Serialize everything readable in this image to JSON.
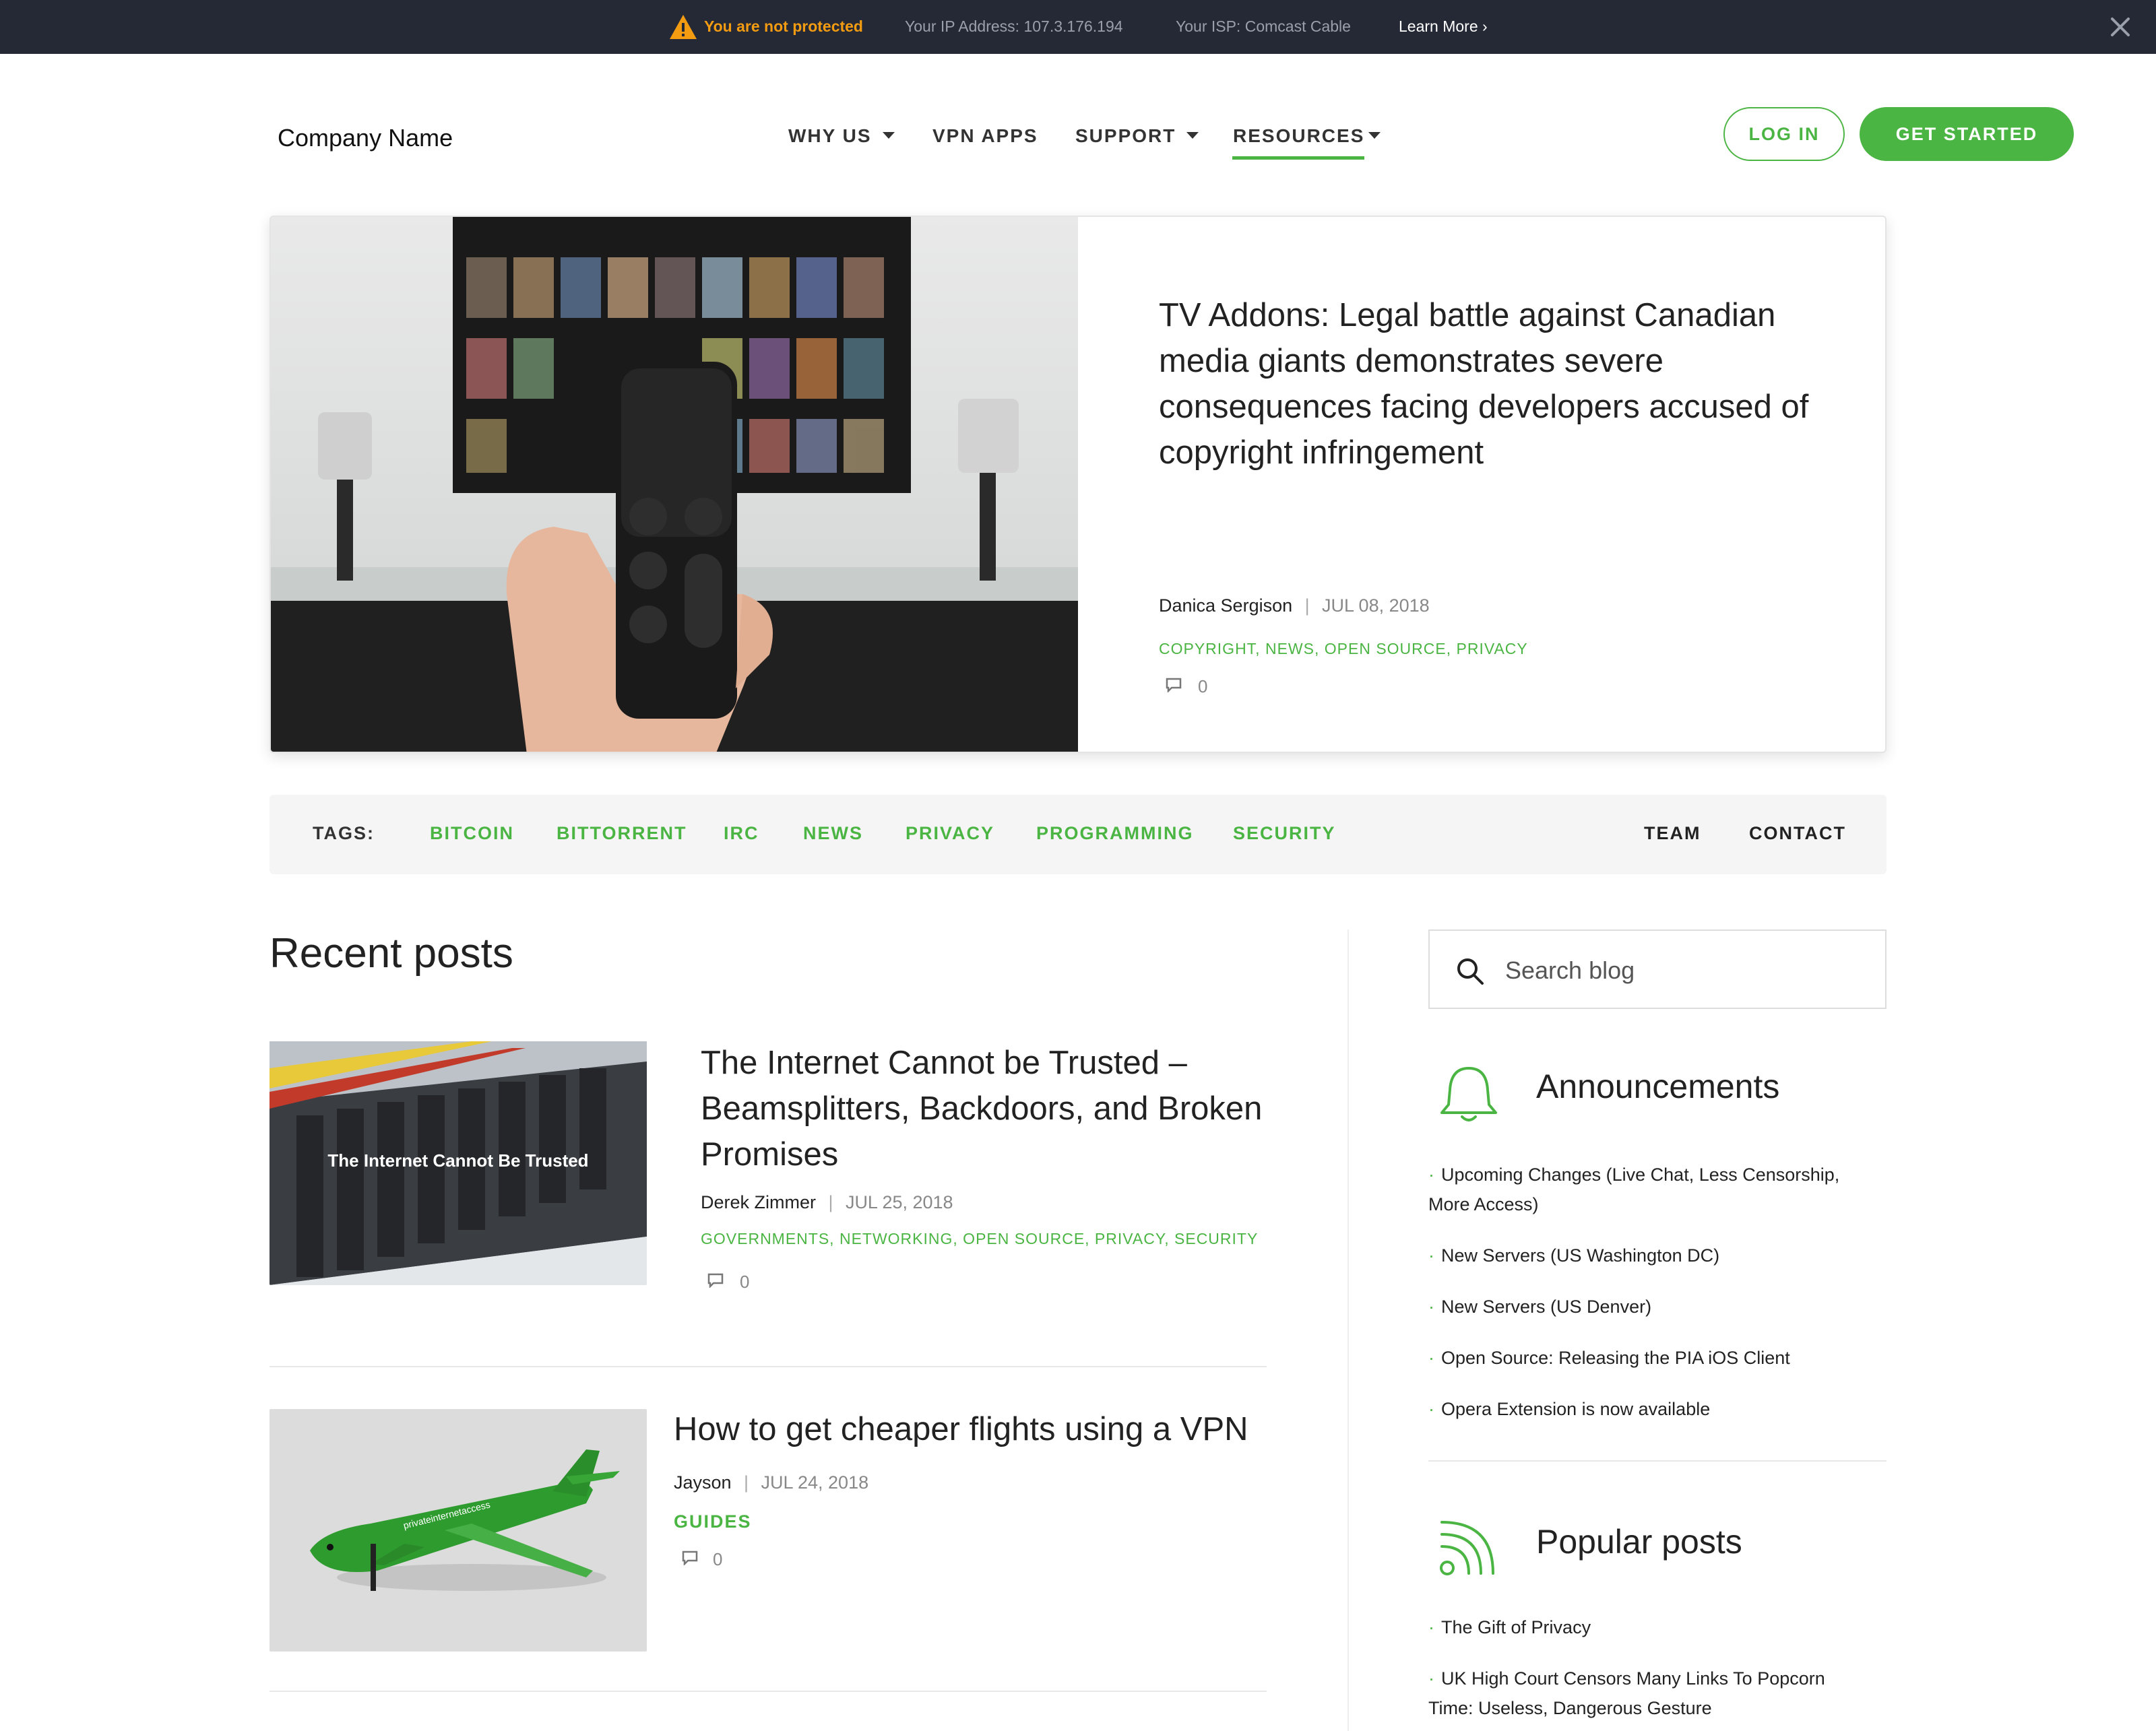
{
  "alert": {
    "status": "You are not protected",
    "ip": "Your IP Address: 107.3.176.194",
    "isp": "Your ISP: Comcast Cable",
    "learn_more": "Learn More ›"
  },
  "header": {
    "logo": "Company Name",
    "nav": [
      "WHY US",
      "VPN APPS",
      "SUPPORT",
      "RESOURCES"
    ],
    "login": "LOG IN",
    "get_started": "GET STARTED"
  },
  "featured": {
    "title": "TV Addons: Legal battle against Canadian media giants demonstrates severe consequences facing developers accused of copyright infringement",
    "author": "Danica Sergison",
    "date": "JUL 08, 2018",
    "tags": "COPYRIGHT, NEWS, OPEN SOURCE, PRIVACY",
    "comments": "0"
  },
  "tagsbar": {
    "label": "TAGS:",
    "tags": [
      "BITCOIN",
      "BITTORRENT",
      "IRC",
      "NEWS",
      "PRIVACY",
      "PROGRAMMING",
      "SECURITY"
    ],
    "right": [
      "TEAM",
      "CONTACT"
    ]
  },
  "recent": {
    "title": "Recent posts",
    "posts": [
      {
        "title": "The Internet Cannot be Trusted – Beamsplitters, Backdoors, and Broken Promises",
        "image_caption": "The Internet Cannot Be Trusted",
        "author": "Derek Zimmer",
        "date": "JUL 25, 2018",
        "tags": "GOVERNMENTS, NETWORKING, OPEN SOURCE, PRIVACY, SECURITY",
        "comments": "0"
      },
      {
        "title": "How to get cheaper flights using a VPN",
        "image_caption": "privateinternetaccess",
        "author": "Jayson",
        "date": "JUL 24, 2018",
        "tags": "GUIDES",
        "comments": "0"
      }
    ]
  },
  "sidebar": {
    "search_placeholder": "Search blog",
    "announcements": {
      "title": "Announcements",
      "items": [
        "Upcoming Changes (Live Chat, Less Censorship, More Access)",
        "New Servers (US Washington DC)",
        "New Servers (US Denver)",
        "Open Source: Releasing the PIA iOS Client",
        "Opera Extension is now available"
      ]
    },
    "popular": {
      "title": "Popular posts",
      "items": [
        "The Gift of Privacy",
        "UK High Court Censors Many Links To Popcorn Time: Useless, Dangerous Gesture"
      ]
    }
  },
  "colors": {
    "accent": "#4bb543",
    "alertbar": "#252935",
    "warning": "#f39c12"
  }
}
